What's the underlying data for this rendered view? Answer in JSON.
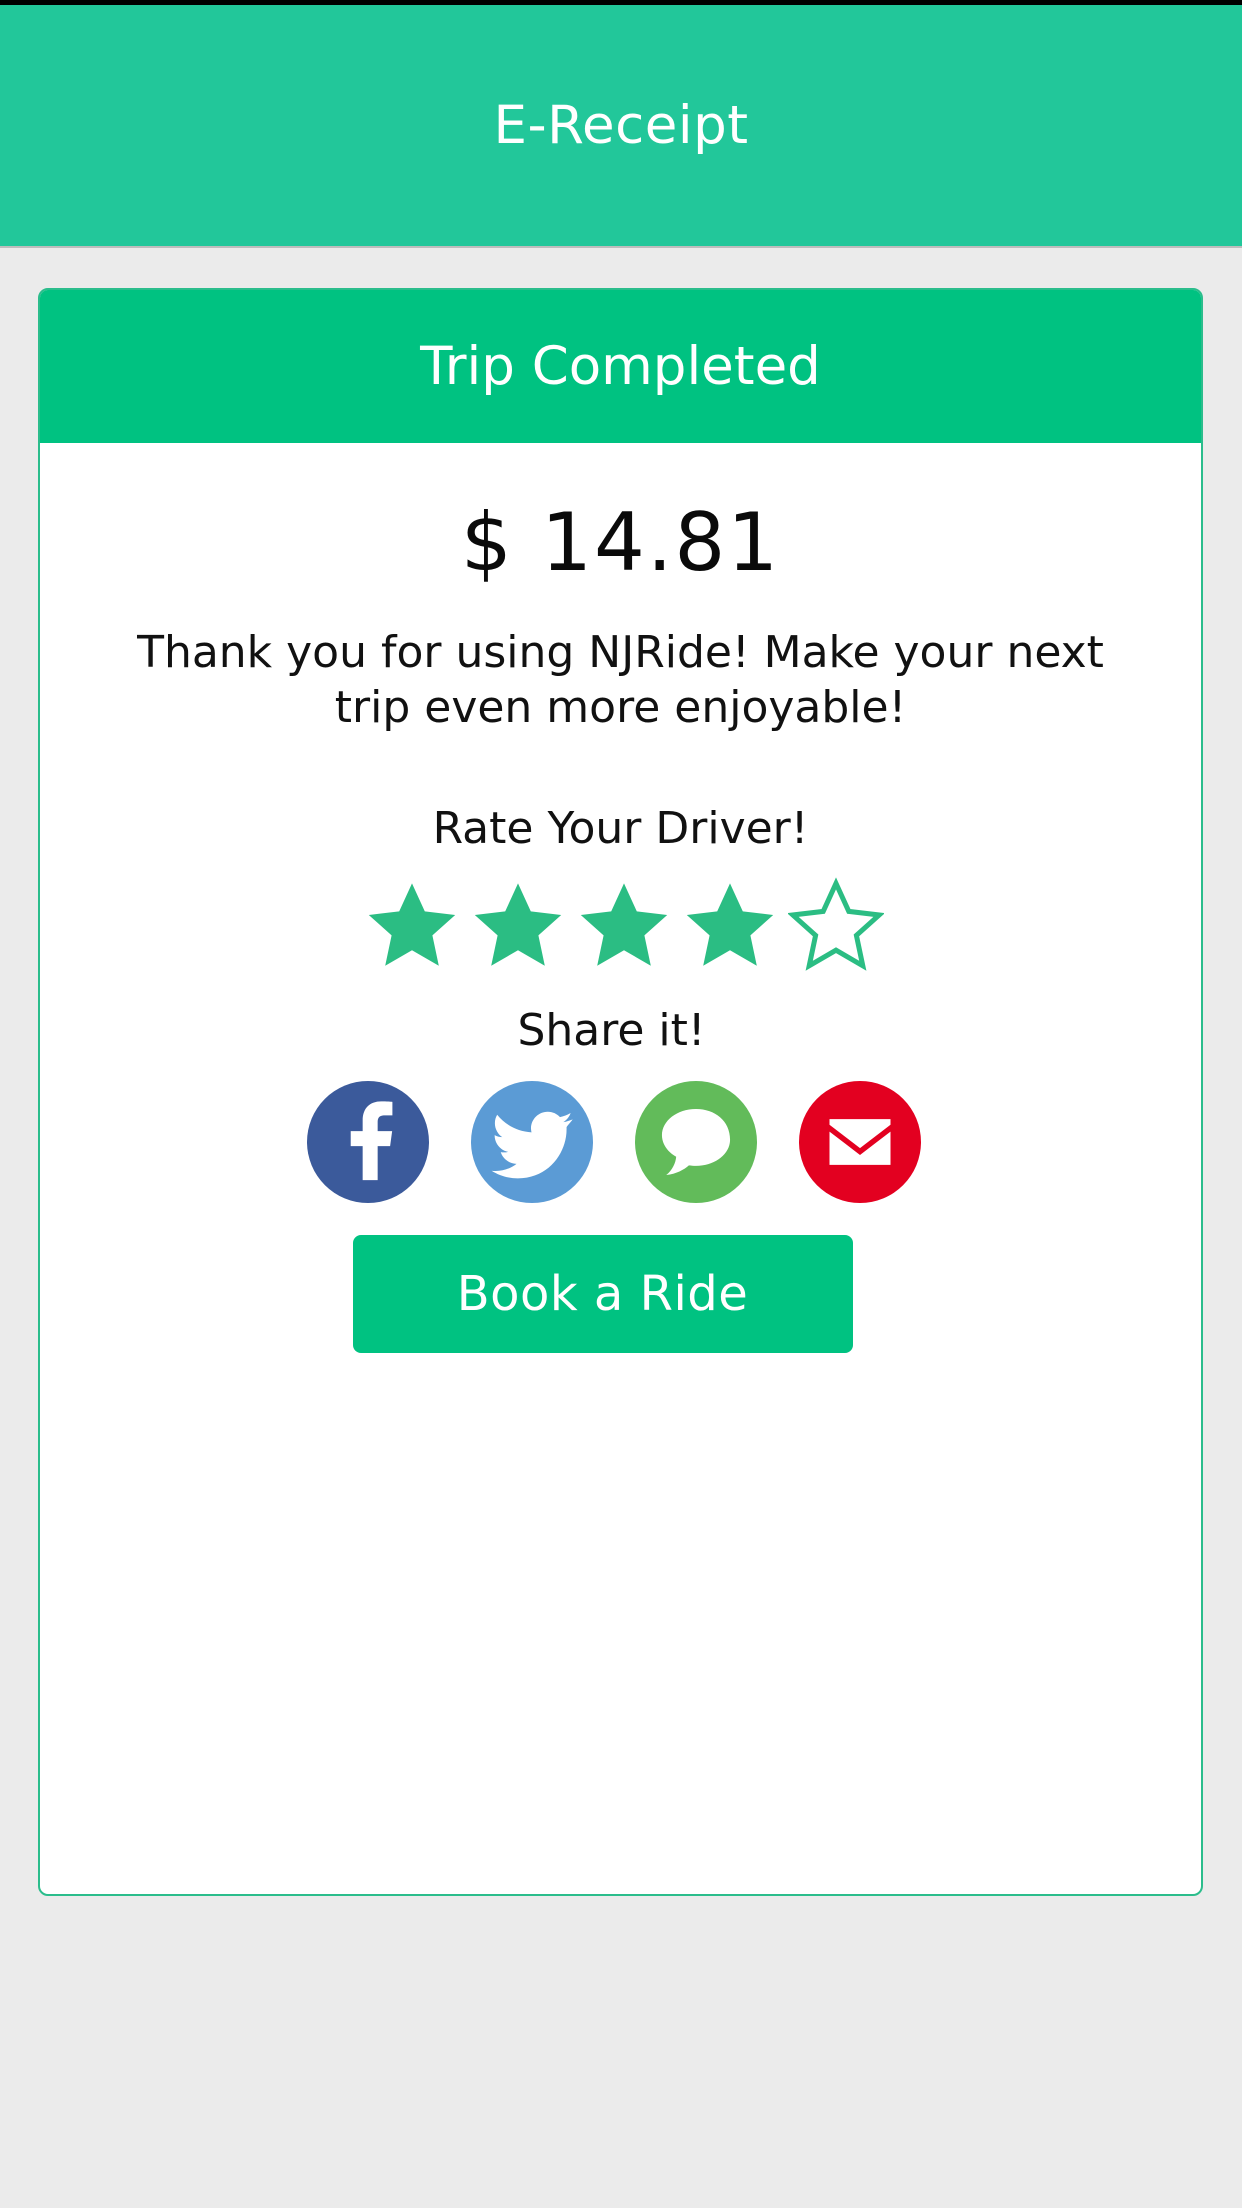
{
  "status_strip": {
    "color": "#000000"
  },
  "app_bar": {
    "title": "E-Receipt",
    "bg_color": "#22c79a",
    "text_color": "#ffffff"
  },
  "page": {
    "bg_color": "#ebebeb"
  },
  "card": {
    "border_color": "#2bbd8c",
    "bg_color": "#ffffff",
    "header": {
      "title": "Trip Completed",
      "bg_color": "#00c281",
      "text_color": "#ffffff"
    },
    "amount": "$ 14.81",
    "message_line1": "Thank you for using NJRide! Make your",
    "message_line2": "next trip even more enjoyable!",
    "rate_label": "Rate Your Driver!",
    "rating": {
      "value": 4,
      "max": 5,
      "color": "#2bbd83",
      "stars": [
        {
          "name": "star-1",
          "filled": true
        },
        {
          "name": "star-2",
          "filled": true
        },
        {
          "name": "star-3",
          "filled": true
        },
        {
          "name": "star-4",
          "filled": true
        },
        {
          "name": "star-5",
          "filled": false
        }
      ]
    },
    "share_label": "Share it!",
    "social": [
      {
        "name": "facebook",
        "label": "Facebook",
        "glyph": "f",
        "color": "#3b5a9b"
      },
      {
        "name": "twitter",
        "label": "Twitter",
        "glyph": "bird",
        "color": "#5b9bd5"
      },
      {
        "name": "message",
        "label": "Message",
        "glyph": "chat-bubble",
        "color": "#62bb5a"
      },
      {
        "name": "email",
        "label": "Email",
        "glyph": "envelope",
        "color": "#e30020"
      }
    ],
    "book_button": {
      "label": "Book a Ride",
      "bg_color": "#00c281",
      "text_color": "#ffffff"
    }
  }
}
